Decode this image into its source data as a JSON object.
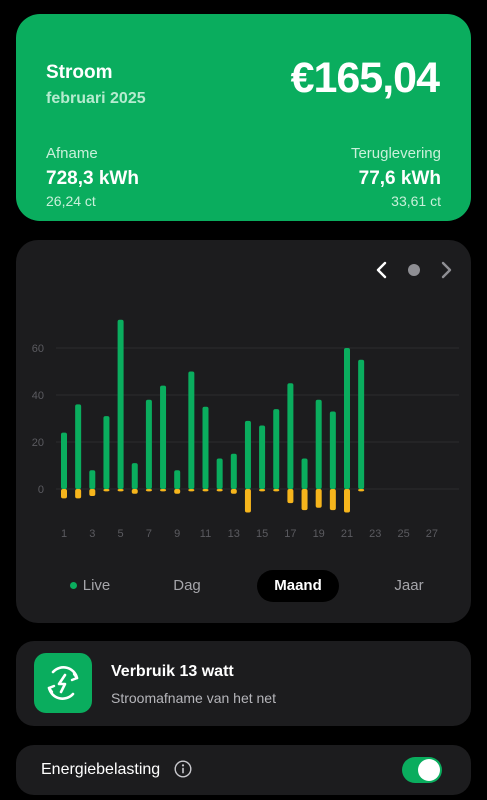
{
  "summary": {
    "title": "Stroom",
    "period": "februari 2025",
    "amount": "€165,04",
    "afname_label": "Afname",
    "afname_value": "728,3 kWh",
    "afname_price": "26,24 ct",
    "terug_label": "Teruglevering",
    "terug_value": "77,6 kWh",
    "terug_price": "33,61 ct"
  },
  "nav": {
    "prev_icon": "chevron-left-icon",
    "dot_icon": "page-dot-icon",
    "next_icon": "chevron-right-icon"
  },
  "chart_data": {
    "type": "bar",
    "categories": [
      "1",
      "2",
      "3",
      "4",
      "5",
      "6",
      "7",
      "8",
      "9",
      "10",
      "11",
      "12",
      "13",
      "14",
      "15",
      "16",
      "17",
      "18",
      "19",
      "20",
      "21",
      "22",
      "23",
      "24",
      "25",
      "26",
      "27",
      "28"
    ],
    "x_tick_labels": [
      "1",
      "3",
      "5",
      "7",
      "9",
      "11",
      "13",
      "15",
      "17",
      "19",
      "21",
      "23",
      "25",
      "27"
    ],
    "y_ticks": [
      0,
      20,
      40,
      60
    ],
    "ylim": [
      -12,
      75
    ],
    "grid": true,
    "series": [
      {
        "values": [
          24,
          36,
          8,
          31,
          72,
          11,
          38,
          44,
          8,
          50,
          35,
          13,
          15,
          29,
          27,
          34,
          45,
          13,
          38,
          33,
          60,
          55,
          null,
          null,
          null,
          null,
          null,
          null
        ],
        "color": "#0aad5e"
      },
      {
        "values": [
          -4,
          -4,
          -3,
          -1,
          -1,
          -2,
          -1,
          -1,
          -2,
          -1,
          -1,
          -1,
          -2,
          -10,
          -1,
          -1,
          -6,
          -9,
          -8,
          -9,
          -10,
          -1,
          null,
          null,
          null,
          null,
          null,
          null
        ],
        "color": "#f6b51c"
      }
    ]
  },
  "tabs": {
    "live": "Live",
    "dag": "Dag",
    "maand": "Maand",
    "jaar": "Jaar"
  },
  "usage": {
    "title": "Verbruik 13 watt",
    "subtitle": "Stroomafname van het net",
    "icon": "power-plug-icon"
  },
  "tax": {
    "label": "Energiebelasting",
    "info_icon": "info-icon",
    "toggle_on": true
  }
}
